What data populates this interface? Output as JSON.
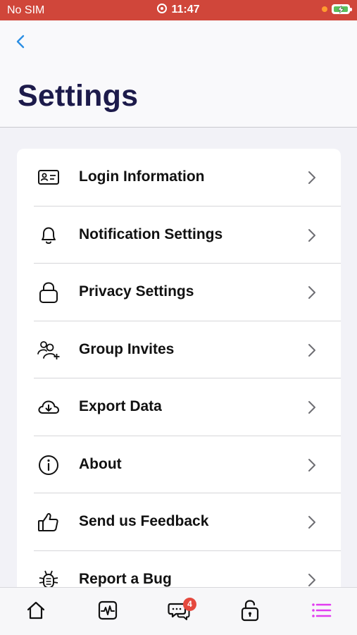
{
  "status_bar": {
    "carrier": "No SIM",
    "time": "11:47",
    "colors": {
      "background": "#d0463a",
      "battery": "#5ac05a",
      "indicator": "#ff9b2f"
    }
  },
  "header": {
    "back_icon": "chevron-left-icon",
    "title": "Settings"
  },
  "settings": {
    "items": [
      {
        "label": "Login Information",
        "icon": "id-card-icon"
      },
      {
        "label": "Notification Settings",
        "icon": "bell-icon"
      },
      {
        "label": "Privacy Settings",
        "icon": "lock-icon"
      },
      {
        "label": "Group Invites",
        "icon": "add-user-icon"
      },
      {
        "label": "Export Data",
        "icon": "cloud-download-icon"
      },
      {
        "label": "About",
        "icon": "info-icon"
      },
      {
        "label": "Send us Feedback",
        "icon": "thumbs-up-icon"
      },
      {
        "label": "Report a Bug",
        "icon": "bug-icon"
      }
    ]
  },
  "tab_bar": {
    "tabs": [
      {
        "icon": "home-icon"
      },
      {
        "icon": "activity-icon"
      },
      {
        "icon": "chat-icon"
      },
      {
        "icon": "unlock-icon"
      },
      {
        "icon": "menu-icon",
        "active": true
      }
    ],
    "chat_badge": "4",
    "colors": {
      "active": "#e13df0",
      "badge": "#e5493e"
    }
  }
}
